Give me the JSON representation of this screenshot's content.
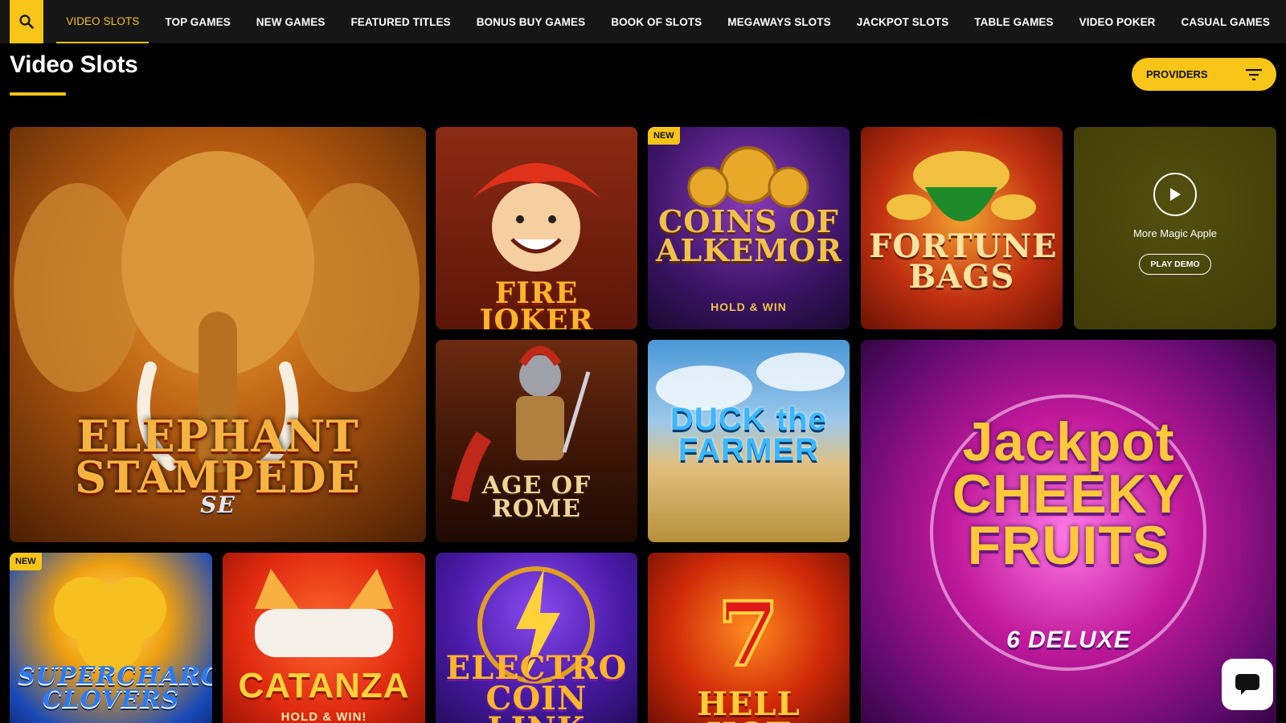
{
  "nav": {
    "items": [
      {
        "label": "VIDEO SLOTS",
        "active": true
      },
      {
        "label": "TOP GAMES"
      },
      {
        "label": "NEW GAMES"
      },
      {
        "label": "FEATURED TITLES"
      },
      {
        "label": "BONUS BUY GAMES"
      },
      {
        "label": "BOOK OF SLOTS"
      },
      {
        "label": "MEGAWAYS SLOTS"
      },
      {
        "label": "JACKPOT SLOTS"
      },
      {
        "label": "TABLE GAMES"
      },
      {
        "label": "VIDEO POKER"
      },
      {
        "label": "CASUAL GAMES"
      }
    ]
  },
  "header": {
    "title": "Video Slots",
    "providers_label": "PROVIDERS"
  },
  "colors": {
    "accent": "#f6c518",
    "background": "#000000",
    "nav_bg": "#161616"
  },
  "badges": {
    "new": "NEW"
  },
  "games": [
    {
      "title": "ELEPHANT STAMPEDE",
      "subtitle": "SE"
    },
    {
      "title": "FIRE JOKER"
    },
    {
      "title": "COINS OF ALKEMOR",
      "subtitle": "HOLD & WIN",
      "badge": "NEW"
    },
    {
      "title": "FORTUNE BAGS"
    },
    {
      "title": "More Magic Apple",
      "hover": true,
      "play_label": "PLAY DEMO"
    },
    {
      "title": "AGE OF ROME"
    },
    {
      "title": "DUCK the FARMER"
    },
    {
      "title": "Jackpot CHEEKY FRUITS",
      "subtitle": "6 DELUXE"
    },
    {
      "title": "SUPERCHARGED CLOVERS",
      "badge": "NEW"
    },
    {
      "title": "CATANZA",
      "subtitle": "HOLD & WIN!"
    },
    {
      "title": "ELECTRO COIN LINK"
    },
    {
      "title": "HELL HOT"
    }
  ],
  "icons": {
    "search": "search-icon",
    "filter": "filter-icon",
    "play": "play-icon",
    "chat": "chat-icon"
  }
}
